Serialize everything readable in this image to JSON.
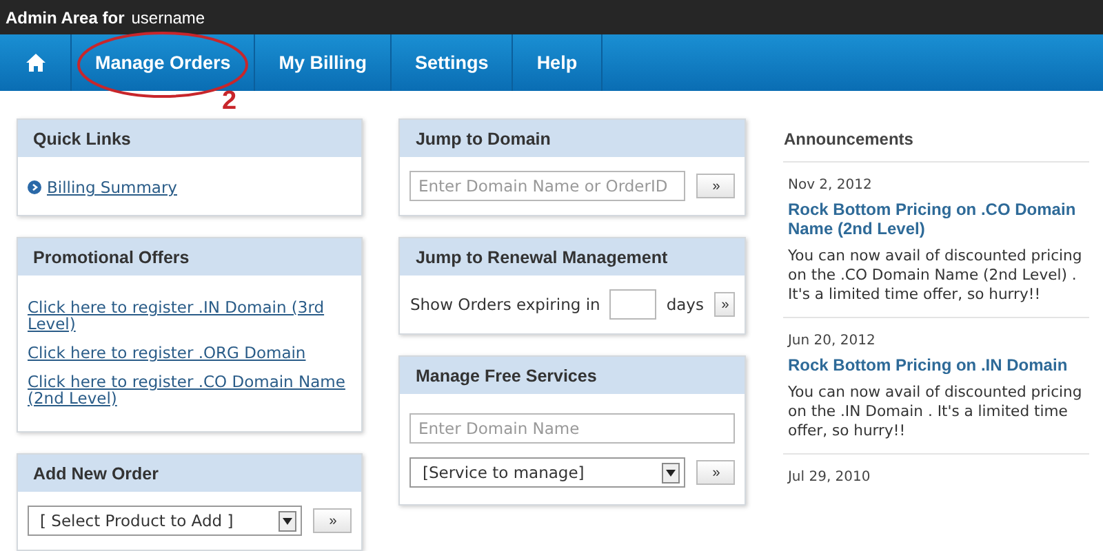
{
  "top_bar": {
    "label": "Admin Area for",
    "username": "username"
  },
  "nav": {
    "items": [
      {
        "label": "Manage Orders"
      },
      {
        "label": "My Billing"
      },
      {
        "label": "Settings"
      },
      {
        "label": "Help"
      }
    ]
  },
  "annotation": {
    "number": "2"
  },
  "quick_links": {
    "title": "Quick Links",
    "links": [
      "Billing Summary"
    ]
  },
  "promotional_offers": {
    "title": "Promotional Offers",
    "links": [
      "Click here to register .IN Domain (3rd Level)",
      "Click here to register .ORG Domain",
      "Click here to register .CO Domain Name (2nd Level)"
    ]
  },
  "add_new_order": {
    "title": "Add New Order",
    "select": "[ Select Product to Add ]",
    "button": "»"
  },
  "jump_to_domain": {
    "title": "Jump to Domain",
    "placeholder": "Enter Domain Name or OrderID",
    "button": "»"
  },
  "renewal": {
    "title": "Jump to Renewal Management",
    "label_before": "Show Orders expiring in",
    "label_after": "days",
    "button": "»"
  },
  "free_services": {
    "title": "Manage Free Services",
    "placeholder": "Enter Domain Name",
    "select": "[Service to manage]",
    "button": "»"
  },
  "announcements": {
    "title": "Announcements",
    "items": [
      {
        "date": "Nov 2, 2012",
        "title": "Rock Bottom Pricing on .CO Domain Name (2nd Level)",
        "body": "You can now avail of discounted pricing on the .CO Domain Name (2nd Level) . It's a limited time offer, so hurry!!"
      },
      {
        "date": "Jun 20, 2012",
        "title": "Rock Bottom Pricing on .IN Domain",
        "body": "You can now avail of discounted pricing on the .IN Domain . It's a limited time offer, so hurry!!"
      },
      {
        "date": "Jul 29, 2010"
      }
    ]
  }
}
